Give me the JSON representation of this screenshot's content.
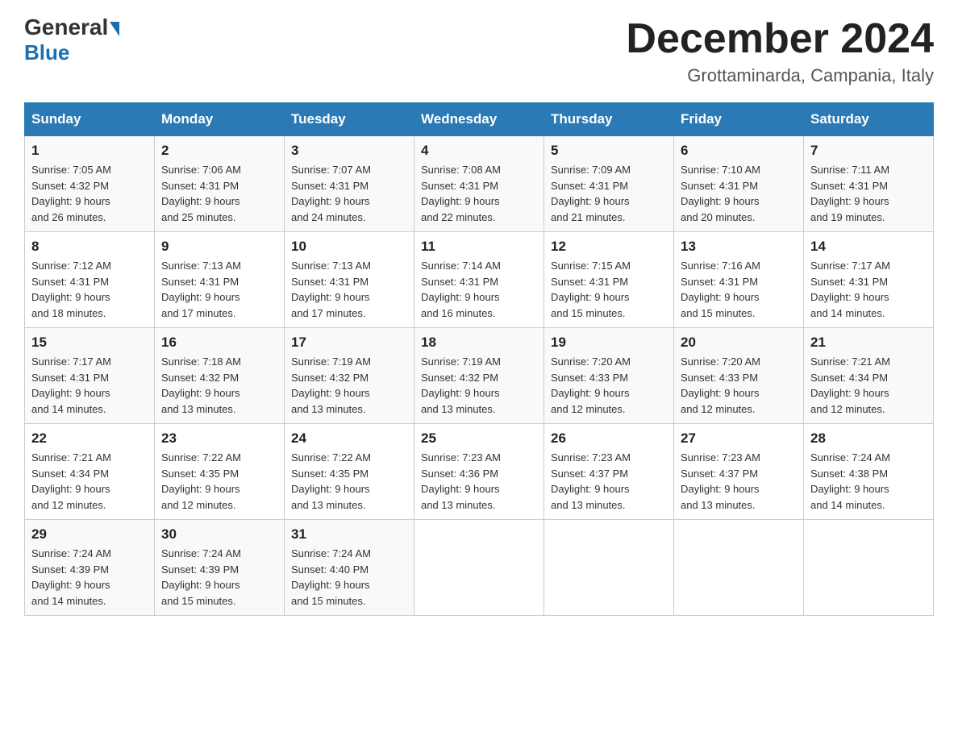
{
  "logo": {
    "line1a": "General",
    "line1b": "Blue"
  },
  "header": {
    "title": "December 2024",
    "location": "Grottaminarda, Campania, Italy"
  },
  "days_of_week": [
    "Sunday",
    "Monday",
    "Tuesday",
    "Wednesday",
    "Thursday",
    "Friday",
    "Saturday"
  ],
  "weeks": [
    [
      {
        "day": "1",
        "sunrise": "7:05 AM",
        "sunset": "4:32 PM",
        "daylight": "9 hours and 26 minutes."
      },
      {
        "day": "2",
        "sunrise": "7:06 AM",
        "sunset": "4:31 PM",
        "daylight": "9 hours and 25 minutes."
      },
      {
        "day": "3",
        "sunrise": "7:07 AM",
        "sunset": "4:31 PM",
        "daylight": "9 hours and 24 minutes."
      },
      {
        "day": "4",
        "sunrise": "7:08 AM",
        "sunset": "4:31 PM",
        "daylight": "9 hours and 22 minutes."
      },
      {
        "day": "5",
        "sunrise": "7:09 AM",
        "sunset": "4:31 PM",
        "daylight": "9 hours and 21 minutes."
      },
      {
        "day": "6",
        "sunrise": "7:10 AM",
        "sunset": "4:31 PM",
        "daylight": "9 hours and 20 minutes."
      },
      {
        "day": "7",
        "sunrise": "7:11 AM",
        "sunset": "4:31 PM",
        "daylight": "9 hours and 19 minutes."
      }
    ],
    [
      {
        "day": "8",
        "sunrise": "7:12 AM",
        "sunset": "4:31 PM",
        "daylight": "9 hours and 18 minutes."
      },
      {
        "day": "9",
        "sunrise": "7:13 AM",
        "sunset": "4:31 PM",
        "daylight": "9 hours and 17 minutes."
      },
      {
        "day": "10",
        "sunrise": "7:13 AM",
        "sunset": "4:31 PM",
        "daylight": "9 hours and 17 minutes."
      },
      {
        "day": "11",
        "sunrise": "7:14 AM",
        "sunset": "4:31 PM",
        "daylight": "9 hours and 16 minutes."
      },
      {
        "day": "12",
        "sunrise": "7:15 AM",
        "sunset": "4:31 PM",
        "daylight": "9 hours and 15 minutes."
      },
      {
        "day": "13",
        "sunrise": "7:16 AM",
        "sunset": "4:31 PM",
        "daylight": "9 hours and 15 minutes."
      },
      {
        "day": "14",
        "sunrise": "7:17 AM",
        "sunset": "4:31 PM",
        "daylight": "9 hours and 14 minutes."
      }
    ],
    [
      {
        "day": "15",
        "sunrise": "7:17 AM",
        "sunset": "4:31 PM",
        "daylight": "9 hours and 14 minutes."
      },
      {
        "day": "16",
        "sunrise": "7:18 AM",
        "sunset": "4:32 PM",
        "daylight": "9 hours and 13 minutes."
      },
      {
        "day": "17",
        "sunrise": "7:19 AM",
        "sunset": "4:32 PM",
        "daylight": "9 hours and 13 minutes."
      },
      {
        "day": "18",
        "sunrise": "7:19 AM",
        "sunset": "4:32 PM",
        "daylight": "9 hours and 13 minutes."
      },
      {
        "day": "19",
        "sunrise": "7:20 AM",
        "sunset": "4:33 PM",
        "daylight": "9 hours and 12 minutes."
      },
      {
        "day": "20",
        "sunrise": "7:20 AM",
        "sunset": "4:33 PM",
        "daylight": "9 hours and 12 minutes."
      },
      {
        "day": "21",
        "sunrise": "7:21 AM",
        "sunset": "4:34 PM",
        "daylight": "9 hours and 12 minutes."
      }
    ],
    [
      {
        "day": "22",
        "sunrise": "7:21 AM",
        "sunset": "4:34 PM",
        "daylight": "9 hours and 12 minutes."
      },
      {
        "day": "23",
        "sunrise": "7:22 AM",
        "sunset": "4:35 PM",
        "daylight": "9 hours and 12 minutes."
      },
      {
        "day": "24",
        "sunrise": "7:22 AM",
        "sunset": "4:35 PM",
        "daylight": "9 hours and 13 minutes."
      },
      {
        "day": "25",
        "sunrise": "7:23 AM",
        "sunset": "4:36 PM",
        "daylight": "9 hours and 13 minutes."
      },
      {
        "day": "26",
        "sunrise": "7:23 AM",
        "sunset": "4:37 PM",
        "daylight": "9 hours and 13 minutes."
      },
      {
        "day": "27",
        "sunrise": "7:23 AM",
        "sunset": "4:37 PM",
        "daylight": "9 hours and 13 minutes."
      },
      {
        "day": "28",
        "sunrise": "7:24 AM",
        "sunset": "4:38 PM",
        "daylight": "9 hours and 14 minutes."
      }
    ],
    [
      {
        "day": "29",
        "sunrise": "7:24 AM",
        "sunset": "4:39 PM",
        "daylight": "9 hours and 14 minutes."
      },
      {
        "day": "30",
        "sunrise": "7:24 AM",
        "sunset": "4:39 PM",
        "daylight": "9 hours and 15 minutes."
      },
      {
        "day": "31",
        "sunrise": "7:24 AM",
        "sunset": "4:40 PM",
        "daylight": "9 hours and 15 minutes."
      },
      null,
      null,
      null,
      null
    ]
  ]
}
